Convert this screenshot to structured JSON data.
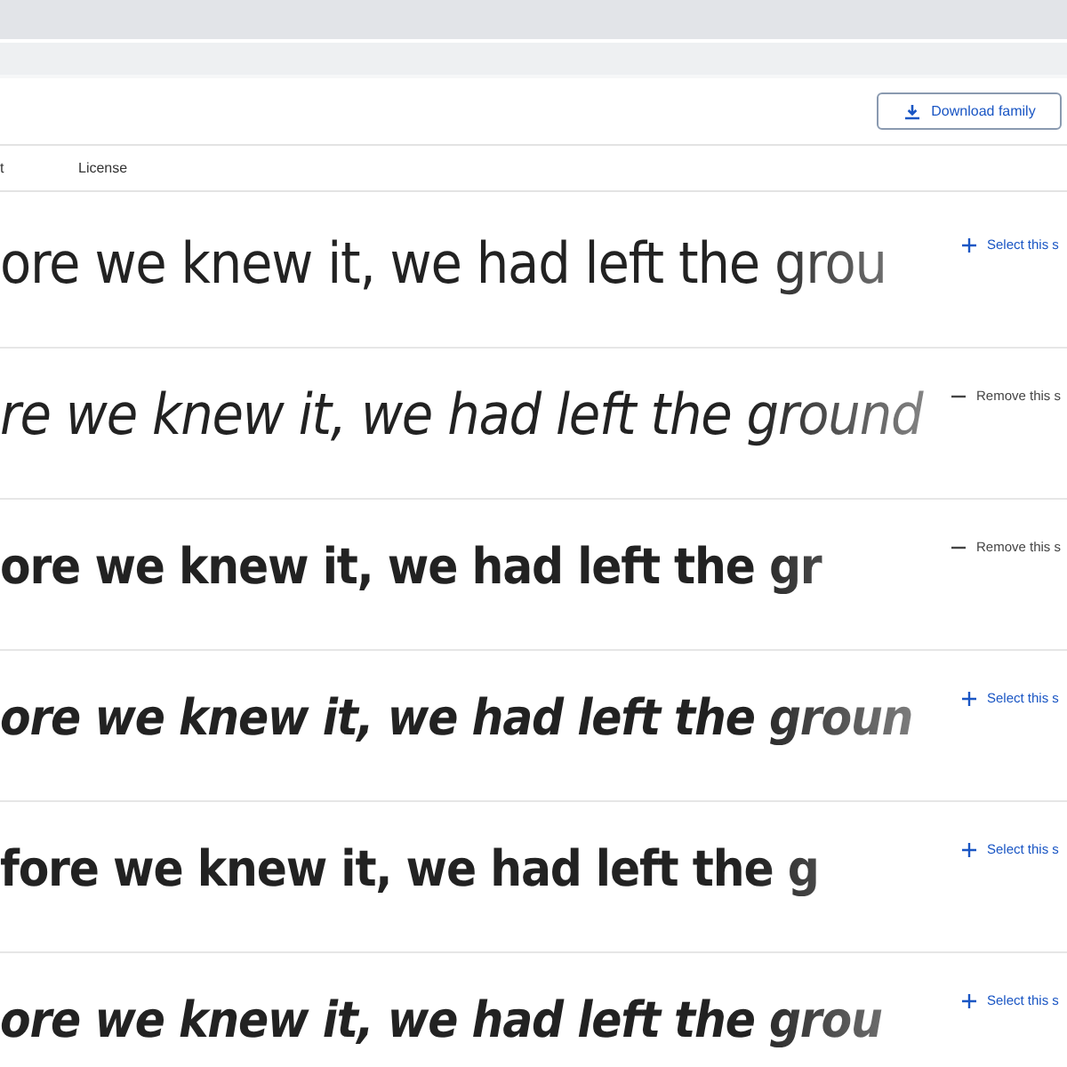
{
  "header": {
    "download_button": "Download family"
  },
  "tabs": [
    {
      "label": "t",
      "selected": false
    },
    {
      "label": "License",
      "selected": false
    }
  ],
  "styles": [
    {
      "sample": "ore we knew it, we had left the grou",
      "kind": "regular",
      "selected": false,
      "action": "Select this s"
    },
    {
      "sample": "re we knew it, we had left the ground",
      "kind": "italic",
      "selected": true,
      "action": "Remove this s"
    },
    {
      "sample": "ore we knew it, we had left the gr",
      "kind": "bold",
      "selected": true,
      "action": "Remove this s"
    },
    {
      "sample": "ore we knew it, we had left the groun",
      "kind": "bold-italic",
      "selected": false,
      "action": "Select this s"
    },
    {
      "sample": "fore we knew it, we had left the g",
      "kind": "black",
      "selected": false,
      "action": "Select this s"
    },
    {
      "sample": "ore we knew it, we had left the grou",
      "kind": "black-italic",
      "selected": false,
      "action": "Select this s"
    }
  ]
}
